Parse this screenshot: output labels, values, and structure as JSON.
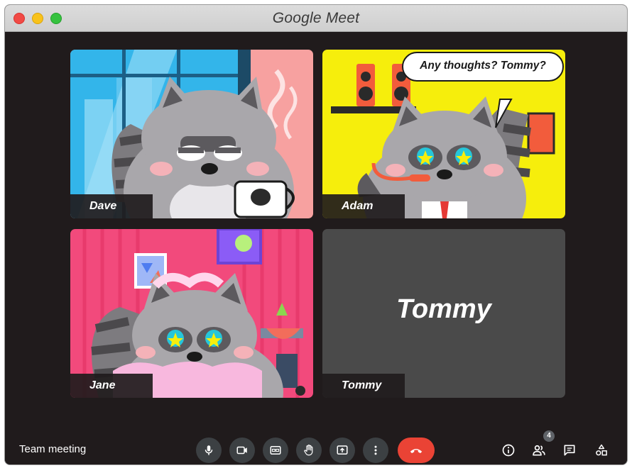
{
  "window": {
    "title": "Google Meet"
  },
  "participants": [
    {
      "name": "Dave"
    },
    {
      "name": "Adam"
    },
    {
      "name": "Jane"
    },
    {
      "name": "Tommy",
      "camera_off": true
    }
  ],
  "speech_bubble": {
    "text": "Any thoughts? Tommy?"
  },
  "tommy_placeholder": "Tommy",
  "meeting": {
    "name": "Team meeting",
    "participant_count": "4"
  },
  "controls": {
    "icons": [
      "microphone-icon",
      "camera-icon",
      "captions-icon",
      "raise-hand-icon",
      "present-screen-icon",
      "more-options-icon",
      "hang-up-icon"
    ],
    "side_icons": [
      "info-icon",
      "people-icon",
      "chat-icon",
      "activities-icon"
    ]
  },
  "colors": {
    "window_bg": "#201b1c",
    "control_bg": "#3c4043",
    "hangup": "#ea4335",
    "adam_bg": "#f6ee0c",
    "jane_bg": "#f24a7c",
    "dave_window": "#2ba8e6",
    "tommy_tile": "#4a4a4a"
  }
}
